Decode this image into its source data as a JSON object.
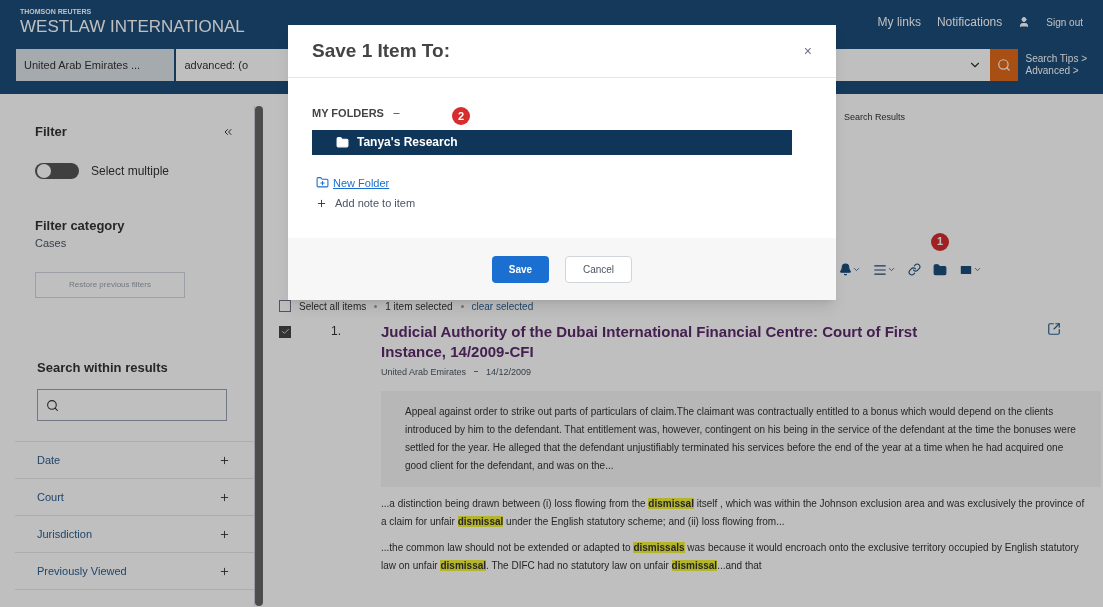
{
  "header": {
    "brand_small": "THOMSON REUTERS",
    "brand": "WESTLAW INTERNATIONAL",
    "nav": [
      "My links",
      "Notifications"
    ],
    "sign_out": "Sign out"
  },
  "search": {
    "jurisdiction": "United Arab Emirates ...",
    "query": "advanced: (o",
    "tips": [
      "Search Tips >",
      "Advanced >"
    ]
  },
  "sidebar": {
    "title": "Filter",
    "toggle": {
      "label": "Select multiple",
      "on": false
    },
    "category_title": "Filter category",
    "category": "Cases",
    "restore_button": "Restore previous filters",
    "search_title": "Search within results",
    "facets": [
      "Date",
      "Court",
      "Jurisdiction",
      "Previously Viewed"
    ]
  },
  "breadcrumb": "Search Results",
  "selection": {
    "checked": false,
    "select_all": "Select all items",
    "selected": "1 item selected",
    "clear": "clear selected"
  },
  "results": [
    {
      "number": "1.",
      "checked": true,
      "title": "Judicial Authority of the Dubai International Financial Centre: Court of First Instance, 14/2009-CFI",
      "jurisdiction": "United Arab Emirates",
      "date": "14/12/2009",
      "summary": "Appeal against order to strike out parts of particulars of claim.The claimant was contractually entitled to a bonus which would depend on the clients introduced by him to the defendant. That entitlement was, however, contingent on his being in the service of the defendant at the time the bonuses were settled for the year. He alleged that the defendant unjustifiably terminated his services before the end of the year at a time when he had acquired one good client for the defendant, and was on the...",
      "snippets": [
        [
          {
            "text": "...a distinction being drawn between (i) loss flowing from the ",
            "highlighted": false
          },
          {
            "text": "dismissal",
            "highlighted": true
          },
          {
            "text": " itself , which was within the Johnson exclusion area and was exclusively the province of a claim for unfair ",
            "highlighted": false
          },
          {
            "text": "dismissal",
            "highlighted": true
          },
          {
            "text": " under the English statutory scheme; and (ii) loss flowing from...",
            "highlighted": false
          }
        ],
        [
          {
            "text": "...the common law should not be extended or adapted to ",
            "highlighted": false
          },
          {
            "text": "dismissals",
            "highlighted": true
          },
          {
            "text": " was because it would encroach onto the exclusive territory occupied by English statutory law on unfair ",
            "highlighted": false
          },
          {
            "text": "dismissal",
            "highlighted": true
          },
          {
            "text": ". The DIFC had no statutory law on unfair ",
            "highlighted": false
          },
          {
            "text": "dismissal",
            "highlighted": true
          },
          {
            "text": "...and that",
            "highlighted": false
          }
        ]
      ]
    }
  ],
  "modal": {
    "title": "Save 1 Item To:",
    "close": "×",
    "folders_label": "MY FOLDERS",
    "folders": [
      {
        "name": "Tanya's Research",
        "selected": true
      }
    ],
    "new_folder": "New Folder",
    "add_note": "Add note to item",
    "save": "Save",
    "cancel": "Cancel"
  },
  "callouts": [
    "2",
    "1"
  ]
}
